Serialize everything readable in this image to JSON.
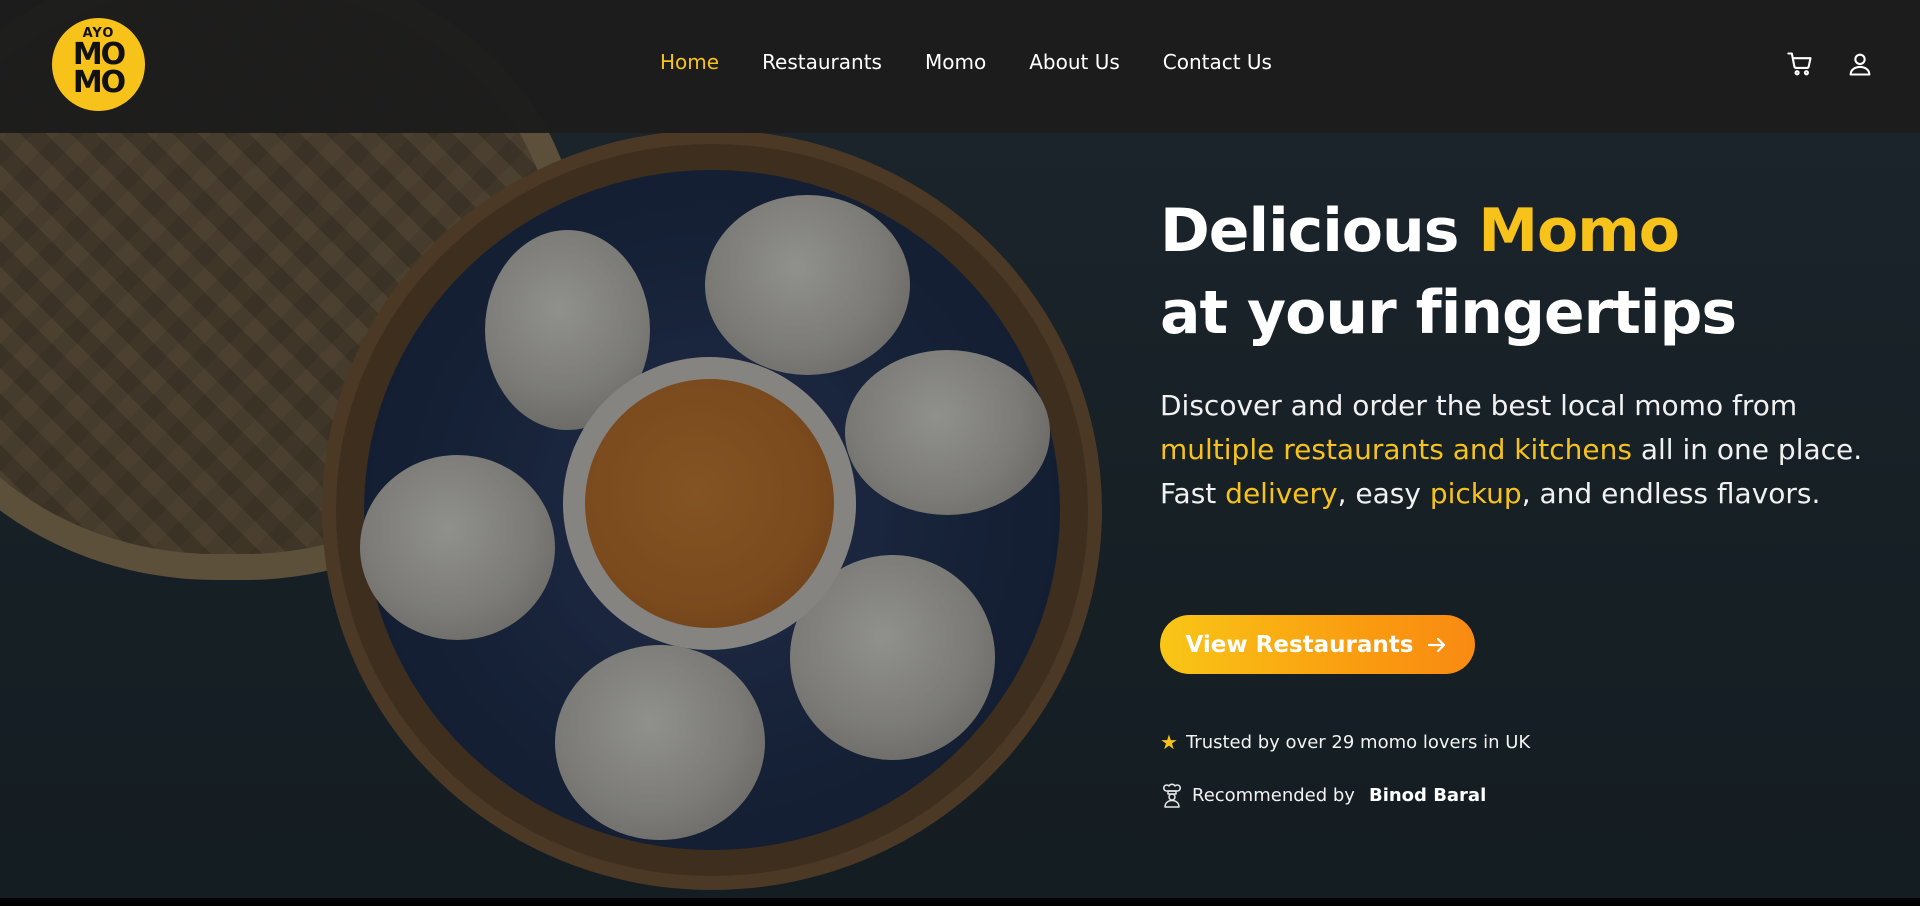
{
  "brand": {
    "logo_top": "AYO",
    "logo_row1": "MO",
    "logo_row2": "MO"
  },
  "nav": {
    "items": [
      {
        "label": "Home",
        "active": true
      },
      {
        "label": "Restaurants",
        "active": false
      },
      {
        "label": "Momo",
        "active": false
      },
      {
        "label": "About Us",
        "active": false
      },
      {
        "label": "Contact Us",
        "active": false
      }
    ],
    "icons": [
      "cart-icon",
      "user-icon"
    ]
  },
  "hero": {
    "title_line1_part1": "Delicious ",
    "title_line1_highlight": "Momo",
    "title_line2": "at your fingertips",
    "desc_part1": "Discover and order the best local momo from ",
    "desc_highlight1": "multiple restaurants and kitchens",
    "desc_part2": " all in one place. Fast ",
    "desc_highlight2": "delivery",
    "desc_part3": ", easy ",
    "desc_highlight3": "pickup",
    "desc_part4": ", and endless flavors.",
    "cta_label": "View Restaurants",
    "trust_text": "Trusted by over 29 momo lovers in UK",
    "recommended_prefix": "Recommended by",
    "recommended_name": "Binod Baral"
  },
  "colors": {
    "accent": "#f7c21a",
    "cta_start": "#f9c616",
    "cta_end": "#f98a12",
    "navbar_bg": "#1c1c1c"
  }
}
